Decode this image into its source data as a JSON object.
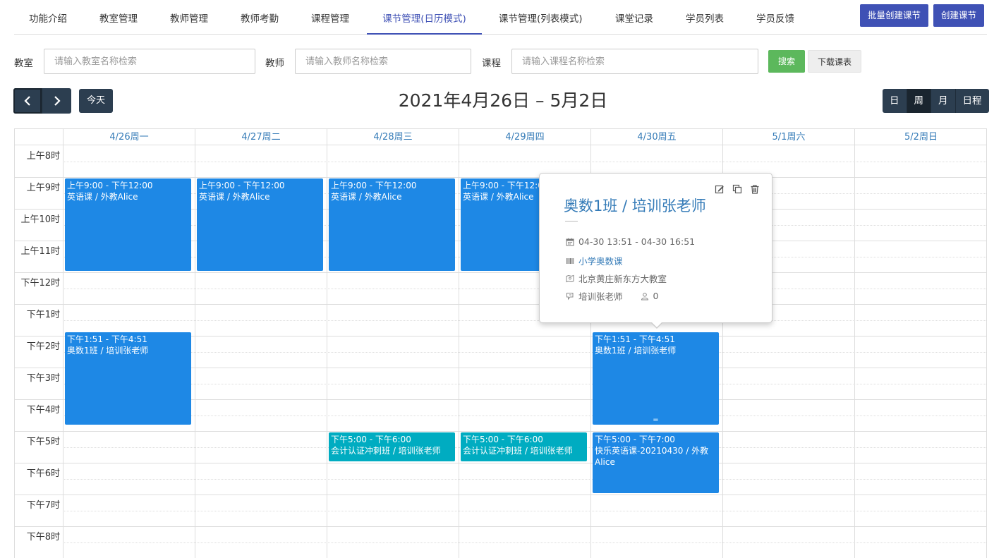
{
  "nav": {
    "tabs": [
      "功能介绍",
      "教室管理",
      "教师管理",
      "教师考勤",
      "课程管理",
      "课节管理(日历模式)",
      "课节管理(列表模式)",
      "课堂记录",
      "学员列表",
      "学员反馈"
    ],
    "active_tab": "课节管理(日历模式)",
    "batch_create": "批量创建课节",
    "create": "创建课节"
  },
  "filters": {
    "classroom_label": "教室",
    "classroom_placeholder": "请输入教室名称检索",
    "teacher_label": "教师",
    "teacher_placeholder": "请输入教师名称检索",
    "course_label": "课程",
    "course_placeholder": "请输入课程名称检索",
    "search": "搜索",
    "download": "下载课表"
  },
  "toolbar": {
    "today": "今天",
    "title": "2021年4月26日 – 5月2日",
    "views": [
      "日",
      "周",
      "月",
      "日程"
    ],
    "active_view": "周"
  },
  "calendar": {
    "days": [
      "4/26周一",
      "4/27周二",
      "4/28周三",
      "4/29周四",
      "4/30周五",
      "5/1周六",
      "5/2周日"
    ],
    "hours": [
      "上午8时",
      "上午9时",
      "上午10时",
      "上午11时",
      "下午12时",
      "下午1时",
      "下午2时",
      "下午3时",
      "下午4时",
      "下午5时",
      "下午6时",
      "下午7时",
      "下午8时"
    ],
    "events": [
      {
        "day": 0,
        "time": "上午9:00 - 下午12:00",
        "title": "英语课 / 外教Alice",
        "start": 9.0,
        "end": 12.0,
        "color": "#1e88e5"
      },
      {
        "day": 1,
        "time": "上午9:00 - 下午12:00",
        "title": "英语课 / 外教Alice",
        "start": 9.0,
        "end": 12.0,
        "color": "#1e88e5"
      },
      {
        "day": 2,
        "time": "上午9:00 - 下午12:00",
        "title": "英语课 / 外教Alice",
        "start": 9.0,
        "end": 12.0,
        "color": "#1e88e5"
      },
      {
        "day": 3,
        "time": "上午9:00 - 下午12:00",
        "title": "英语课 / 外教Alice",
        "start": 9.0,
        "end": 12.0,
        "color": "#1e88e5"
      },
      {
        "day": 0,
        "time": "下午1:51 - 下午4:51",
        "title": "奥数1班 / 培训张老师",
        "start": 13.85,
        "end": 16.85,
        "color": "#1e88e5"
      },
      {
        "day": 4,
        "time": "下午1:51 - 下午4:51",
        "title": "奥数1班 / 培训张老师",
        "start": 13.85,
        "end": 16.85,
        "color": "#1e88e5",
        "resizer": "="
      },
      {
        "day": 2,
        "time": "下午5:00 - 下午6:00",
        "title": "会计认证冲刺班 / 培训张老师",
        "start": 17.0,
        "end": 18.0,
        "color": "#00acc1"
      },
      {
        "day": 3,
        "time": "下午5:00 - 下午6:00",
        "title": "会计认证冲刺班 / 培训张老师",
        "start": 17.0,
        "end": 18.0,
        "color": "#00acc1"
      },
      {
        "day": 4,
        "time": "下午5:00 - 下午7:00",
        "title": "快乐英语课-20210430 / 外教Alice",
        "start": 17.0,
        "end": 19.0,
        "color": "#1e88e5"
      }
    ]
  },
  "popover": {
    "title": "奥数1班 / 培训张老师",
    "datetime": "04-30 13:51 - 04-30 16:51",
    "course": "小学奥数课",
    "classroom": "北京黄庄新东方大教室",
    "teacher": "培训张老师",
    "students": "0",
    "icons": [
      "edit-icon",
      "copy-icon",
      "delete-icon",
      "calendar-icon",
      "course-icon",
      "classroom-icon",
      "teacher-icon",
      "student-icon"
    ]
  }
}
